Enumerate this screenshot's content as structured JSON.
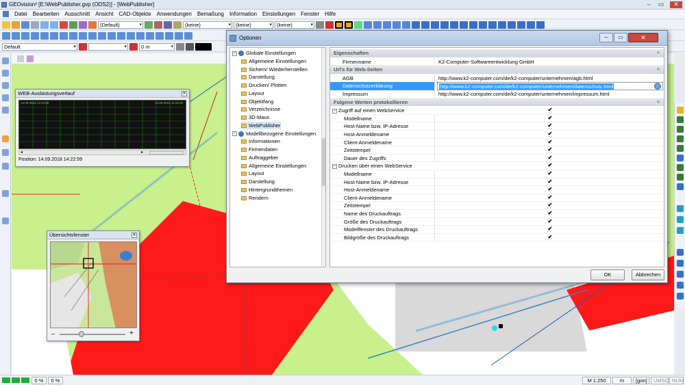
{
  "app": {
    "title": "GEOvision³ [E:\\WebPublisher.gvp (ODS2)] - [WebPublisher]",
    "min": "–",
    "restore": "▭",
    "close": "✕"
  },
  "menu": [
    "Datei",
    "Bearbeiten",
    "Ausschnitt",
    "Ansicht",
    "CAD-Objekte",
    "Anwendungen",
    "Bemaßung",
    "Information",
    "Einstellungen",
    "Fenster",
    "Hilfe"
  ],
  "toolbar": {
    "combo_default": "(Default)",
    "combo_none_1": "(keine)",
    "combo_none_2": "(keine)",
    "combo_none_3": "(keine)",
    "combo_style": "Default",
    "combo_len": "0 m"
  },
  "web_window": {
    "title": "WEB-Auslastungsverlauf",
    "ts_left": "14.09.2018 14:22:59",
    "ts_right": "14.09.2018 14:22:59",
    "position": "Position: 14.09.2018 14:22:59"
  },
  "overview_window": {
    "title": "Übersichtsfenster",
    "minus": "–",
    "plus": "+"
  },
  "dialog": {
    "title": "Optionen",
    "tree": [
      {
        "label": "Globale Einstellungen",
        "level": 0,
        "type": "root",
        "exp": "–"
      },
      {
        "label": "Allgemeine Einstellungen",
        "level": 1,
        "type": "folder"
      },
      {
        "label": "Sichern/ Wiederherstellen",
        "level": 1,
        "type": "folder"
      },
      {
        "label": "Darstellung",
        "level": 1,
        "type": "folder"
      },
      {
        "label": "Drucken/ Plotten",
        "level": 1,
        "type": "folder"
      },
      {
        "label": "Layout",
        "level": 1,
        "type": "folder"
      },
      {
        "label": "Objektfang",
        "level": 1,
        "type": "folder"
      },
      {
        "label": "Verzeichnisse",
        "level": 1,
        "type": "folder"
      },
      {
        "label": "3D-Maus",
        "level": 1,
        "type": "folder"
      },
      {
        "label": "WebPublisher",
        "level": 1,
        "type": "folder",
        "selected": true
      },
      {
        "label": "Modellbezogene Einstellungen",
        "level": 0,
        "type": "root",
        "exp": "–"
      },
      {
        "label": "Informationen",
        "level": 1,
        "type": "folder"
      },
      {
        "label": "Firmendaten",
        "level": 1,
        "type": "folder"
      },
      {
        "label": "Auftraggeber",
        "level": 1,
        "type": "folder"
      },
      {
        "label": "Allgemeine Einstellungen",
        "level": 1,
        "type": "folder"
      },
      {
        "label": "Layout",
        "level": 1,
        "type": "folder"
      },
      {
        "label": "Darstellung",
        "level": 1,
        "type": "folder"
      },
      {
        "label": "Hintergrundthemen",
        "level": 1,
        "type": "folder"
      },
      {
        "label": "Rendern",
        "level": 1,
        "type": "folder"
      }
    ],
    "sections": {
      "eigenschaften": "Eigenschaften",
      "urls": "Url's für Web-Seiten",
      "log": "Folgene Werten protokollieren",
      "collapse": "≈"
    },
    "firmenname_label": "Firmenname",
    "firmenname_value": "K2-Computer-Softwareentwicklung GmbH",
    "urls": [
      {
        "label": "AGB",
        "value": "http://www.k2-computer.com/de/k2-computer/unternehmen/agb.html",
        "selected": false
      },
      {
        "label": "Datenschutzerklärung",
        "value": "http://www.k2-computer.com/de/k2-computer/unternehmen/datenschutz.html",
        "selected": true
      },
      {
        "label": "Impressum",
        "value": "http://www.k2-computer.com/de/k2-computer/unternehmen/impressum.html",
        "selected": false
      }
    ],
    "group1": {
      "label": "Zugriff auf einen WebService",
      "exp": "–",
      "items": [
        "Modellname",
        "Host-Name bzw. IP-Adresse",
        "Host-Anmeldename",
        "Client-Anmeldename",
        "Zeitstempel",
        "Dauer des Zugriffs"
      ]
    },
    "group2": {
      "label": "Drucken über einen WebService",
      "exp": "–",
      "items": [
        "Modellname",
        "Host-Name bzw. IP-Adresse",
        "Host-Anmeldename",
        "Client-Anmeldename",
        "Zeitstempel",
        "Name des Druckauftrags",
        "Größe des Druckauftrags",
        "Modellfenster des Druckauftrags",
        "Bildgröße des Druckauftrags"
      ]
    },
    "check_mark": "✔",
    "ok": "OK",
    "cancel": "Abbrechen"
  },
  "status": {
    "pct1": "0 %",
    "pct2": "0 %",
    "scale": "M 1:250",
    "unit": "m",
    "gon": "[gon]",
    "umsch": "UMSCH",
    "num": "NUM"
  },
  "colors": {
    "map_green": "#c8f08c",
    "map_red": "#ff1a1a",
    "map_grey": "#d9d9d9",
    "selection": "#3399ff",
    "chart_bg": "#111111",
    "chart_grid": "#1e7a1e"
  }
}
